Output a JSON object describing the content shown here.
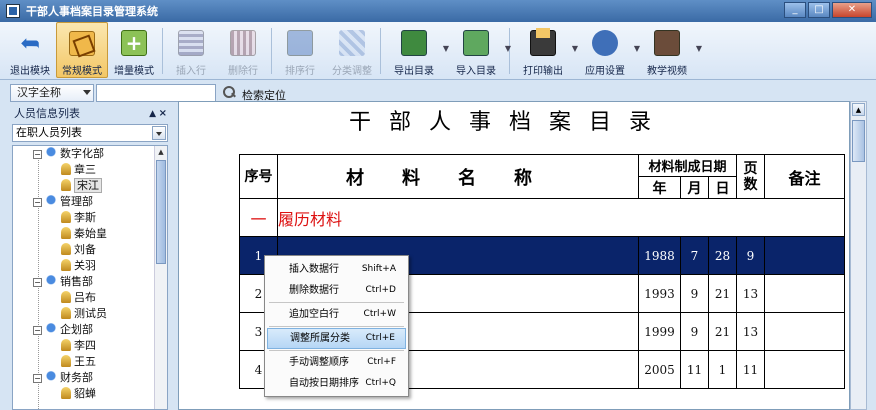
{
  "window": {
    "title": "干部人事档案目录管理系统",
    "min": "_",
    "max": "□",
    "close": "✕"
  },
  "toolbar": [
    {
      "label": "退出模块",
      "icon": "back-icon"
    },
    {
      "label": "常规模式",
      "icon": "normal-mode-icon",
      "active": true
    },
    {
      "label": "增量模式",
      "icon": "add-mode-icon"
    },
    {
      "label": "插入行",
      "icon": "insert-row-icon",
      "disabled": true
    },
    {
      "label": "删除行",
      "icon": "delete-row-icon",
      "disabled": true
    },
    {
      "label": "排序行",
      "icon": "sort-row-icon",
      "disabled": true
    },
    {
      "label": "分类调整",
      "icon": "classify-icon",
      "disabled": true
    },
    {
      "label": "导出目录",
      "icon": "export-icon"
    },
    {
      "label": "导入目录",
      "icon": "import-icon"
    },
    {
      "label": "打印输出",
      "icon": "print-icon"
    },
    {
      "label": "应用设置",
      "icon": "settings-icon"
    },
    {
      "label": "教学视频",
      "icon": "video-icon"
    }
  ],
  "search": {
    "mode": "汉字全称",
    "placeholder": "",
    "button_label": "检索定位"
  },
  "panel": {
    "title": "人员信息列表",
    "list_select": "在职人员列表",
    "tree": [
      {
        "type": "dept",
        "label": "数字化部"
      },
      {
        "type": "person",
        "label": "章三"
      },
      {
        "type": "person",
        "label": "宋江",
        "selected": true
      },
      {
        "type": "dept",
        "label": "管理部"
      },
      {
        "type": "person",
        "label": "李斯"
      },
      {
        "type": "person",
        "label": "秦始皇"
      },
      {
        "type": "person",
        "label": "刘备"
      },
      {
        "type": "person",
        "label": "关羽"
      },
      {
        "type": "dept",
        "label": "销售部"
      },
      {
        "type": "person",
        "label": "吕布"
      },
      {
        "type": "person",
        "label": "测试员"
      },
      {
        "type": "dept",
        "label": "企划部"
      },
      {
        "type": "person",
        "label": "李四"
      },
      {
        "type": "person",
        "label": "王五"
      },
      {
        "type": "dept",
        "label": "财务部"
      },
      {
        "type": "person",
        "label": "貂蝉"
      }
    ]
  },
  "document": {
    "title": "干部人事档案目录",
    "headers": {
      "seq": "序号",
      "name": "材料名称",
      "date": "材料制成日期",
      "year": "年",
      "month": "月",
      "day": "日",
      "pages": "页数",
      "note": "备注"
    },
    "category": {
      "no": "一",
      "name": "履历材料"
    },
    "rows": [
      {
        "seq": "1",
        "name": "",
        "year": "1988",
        "month": "7",
        "day": "28",
        "pages": "9",
        "note": "",
        "selected": true
      },
      {
        "seq": "2",
        "name": "",
        "year": "1993",
        "month": "9",
        "day": "21",
        "pages": "13",
        "note": ""
      },
      {
        "seq": "3",
        "name": "",
        "year": "1999",
        "month": "9",
        "day": "21",
        "pages": "13",
        "note": ""
      },
      {
        "seq": "4",
        "name": "",
        "year": "2005",
        "month": "11",
        "day": "1",
        "pages": "11",
        "note": ""
      }
    ]
  },
  "context_menu": {
    "items": [
      {
        "label": "插入数据行",
        "shortcut": "Shift+A"
      },
      {
        "label": "删除数据行",
        "shortcut": "Ctrl+D"
      },
      {
        "sep": true
      },
      {
        "label": "追加空白行",
        "shortcut": "Ctrl+W"
      },
      {
        "sep": true
      },
      {
        "label": "调整所属分类",
        "shortcut": "Ctrl+E",
        "highlighted": true
      },
      {
        "sep": true
      },
      {
        "label": "手动调整顺序",
        "shortcut": "Ctrl+F"
      },
      {
        "label": "自动按日期排序",
        "shortcut": "Ctrl+Q"
      }
    ]
  }
}
